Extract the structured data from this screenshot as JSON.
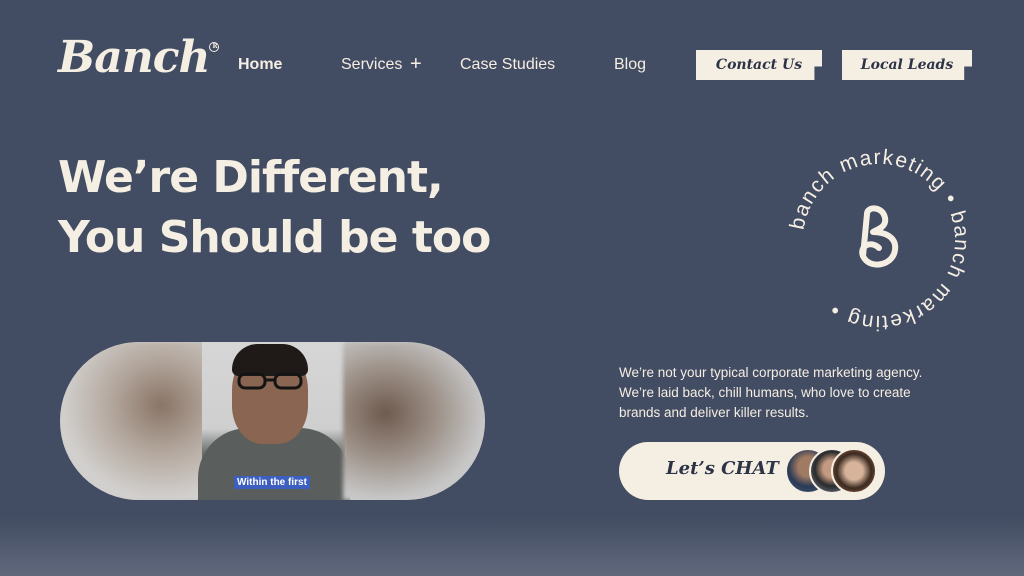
{
  "header": {
    "logo": "Banch",
    "nav": {
      "home": "Home",
      "services": "Services",
      "services_toggle": "+",
      "case_studies": "Case Studies",
      "blog": "Blog"
    },
    "buttons": {
      "contact": "Contact Us",
      "leads": "Local Leads"
    }
  },
  "hero": {
    "title_line1": "We’re Different,",
    "title_line2": "You Should be too"
  },
  "badge": {
    "ring_text": "banch marketing • banch marketing •",
    "monogram": "B"
  },
  "video": {
    "caption": "Within the first"
  },
  "intro": {
    "line1": "We’re not your typical corporate marketing agency.",
    "line2": "We’re laid back, chill humans, who love to create",
    "line3": "brands and deliver killer results."
  },
  "chat": {
    "label": "Let’s CHAT"
  },
  "colors": {
    "background": "#424c62",
    "cream": "#f5eee3",
    "ink": "#2d3346",
    "caption_bg": "#3d5fbf"
  }
}
